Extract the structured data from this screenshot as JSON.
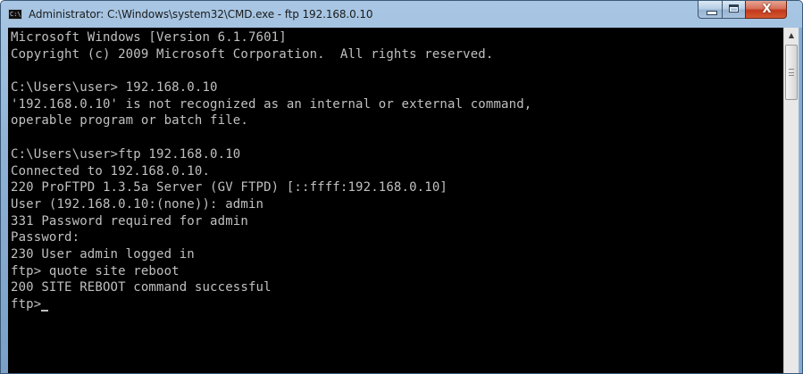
{
  "window": {
    "title": "Administrator: C:\\Windows\\system32\\CMD.exe - ftp  192.168.0.10",
    "icon_text": "C:\\"
  },
  "console": {
    "lines": [
      "Microsoft Windows [Version 6.1.7601]",
      "Copyright (c) 2009 Microsoft Corporation.  All rights reserved.",
      "",
      "C:\\Users\\user> 192.168.0.10",
      "'192.168.0.10' is not recognized as an internal or external command,",
      "operable program or batch file.",
      "",
      "C:\\Users\\user>ftp 192.168.0.10",
      "Connected to 192.168.0.10.",
      "220 ProFTPD 1.3.5a Server (GV FTPD) [::ffff:192.168.0.10]",
      "User (192.168.0.10:(none)): admin",
      "331 Password required for admin",
      "Password:",
      "230 User admin logged in",
      "ftp> quote site reboot",
      "200 SITE REBOOT command successful",
      "ftp>"
    ]
  },
  "caption": {
    "close_glyph": "X"
  },
  "scrollbar": {
    "up_glyph": "▲"
  },
  "colors": {
    "console_background": "#000000",
    "console_text": "#c0c0c0",
    "close_button": "#c2381d",
    "title_bar": "#a9c7e4"
  },
  "icons": {
    "app": "console-icon",
    "minimize": "minimize-icon",
    "maximize": "maximize-icon",
    "close": "close-icon"
  }
}
